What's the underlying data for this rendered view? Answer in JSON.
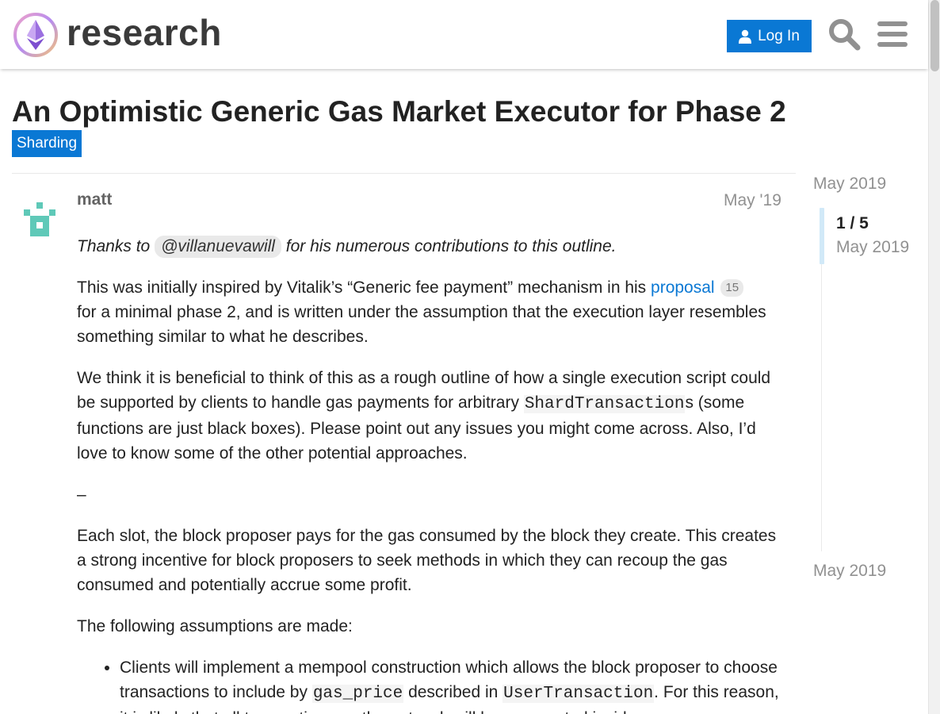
{
  "header": {
    "brand": "research",
    "login_label": "Log In",
    "icons": {
      "logo": "ethereum-logo",
      "user": "user-icon",
      "search": "search-icon",
      "menu": "hamburger-menu-icon"
    },
    "colors": {
      "primary": "#0a78d4"
    }
  },
  "topic": {
    "title": "An Optimistic Generic Gas Market Executor for Phase 2",
    "category": "Sharding"
  },
  "post": {
    "username": "matt",
    "date": "May '19",
    "p1_pre": "Thanks to ",
    "p1_mention": "@villanuevawill",
    "p1_post": " for his numerous contributions to this outline.",
    "p2_pre": "This was initially inspired by Vitalik’s “Generic fee payment” mechanism in his ",
    "p2_link": "proposal",
    "p2_badge": "15",
    "p2_post": " for a minimal phase 2, and is written under the assumption that the execution layer resembles something similar to what he describes.",
    "p3_pre": "We think it is beneficial to think of this as a rough outline of how a single execution script could be supported by clients to handle gas payments for arbitrary ",
    "p3_code": "ShardTransaction",
    "p3_post": "s (some functions are just black boxes). Please point out any issues you might come across. Also, I’d love to know some of the other potential approaches.",
    "p4": "–",
    "p5": "Each slot, the block proposer pays for the gas consumed by the block they create. This creates a strong incentive for block proposers to seek methods in which they can recoup the gas consumed and potentially accrue some profit.",
    "p6": "The following assumptions are made:",
    "li1_pre": "Clients will implement a mempool construction which allows the block proposer to choose transactions to include by ",
    "li1_code1": "gas_price",
    "li1_mid": " described in ",
    "li1_code2": "UserTransaction",
    "li1_post": ". For this reason, it is likely that all transactions on the network will be propagated inside a"
  },
  "timeline": {
    "top_date": "May 2019",
    "count": "1 / 5",
    "current_date": "May 2019",
    "bottom_date": "May 2019"
  }
}
